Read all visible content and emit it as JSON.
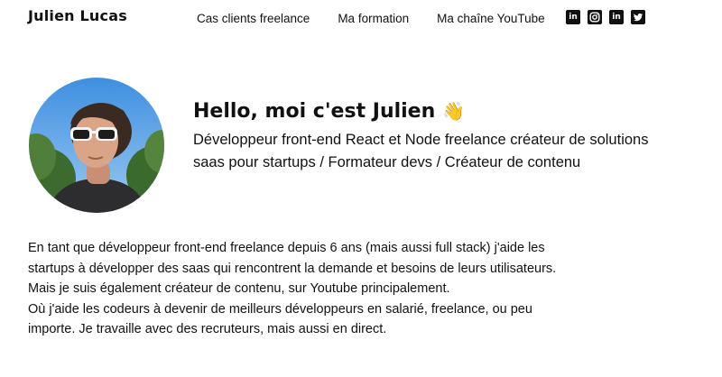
{
  "header": {
    "brand": "Julien Lucas",
    "nav": [
      {
        "label": "Cas clients freelance"
      },
      {
        "label": "Ma formation"
      },
      {
        "label": "Ma chaîne YouTube"
      }
    ],
    "socials": [
      {
        "icon": "linkedin-icon",
        "glyph": "in"
      },
      {
        "icon": "instagram-icon"
      },
      {
        "icon": "linkedin-icon",
        "glyph": "in"
      },
      {
        "icon": "twitter-icon"
      }
    ]
  },
  "intro": {
    "title": "Hello, moi c'est Julien",
    "emoji": "👋",
    "subtitle": "Développeur front-end React et Node freelance créateur de solutions saas pour startups / Formateur devs / Créateur de contenu"
  },
  "bio": {
    "lines": [
      "En tant que développeur front-end freelance depuis 6 ans (mais aussi full stack) j'aide les",
      "startups à développer des saas qui rencontrent la demande et besoins de leurs utilisateurs.",
      "Mais je suis également créateur de contenu, sur Youtube principalement.",
      "Où j'aide les codeurs à devenir de meilleurs développeurs en salarié, freelance, ou peu",
      "importe. Je travaille avec des recruteurs, mais aussi en direct."
    ]
  },
  "colors": {
    "text": "#111111",
    "background": "#ffffff"
  }
}
